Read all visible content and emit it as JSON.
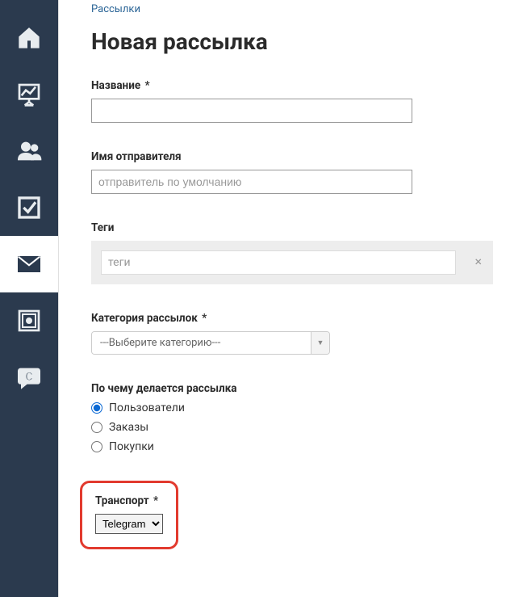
{
  "breadcrumb": "Рассылки",
  "page_title": "Новая рассылка",
  "fields": {
    "name": {
      "label": "Название",
      "required": "*",
      "value": ""
    },
    "sender": {
      "label": "Имя отправителя",
      "placeholder": "отправитель по умолчанию",
      "value": ""
    },
    "tags": {
      "label": "Теги",
      "placeholder": "теги"
    },
    "category": {
      "label": "Категория рассылок",
      "required": "*",
      "selected": "---Выберите категорию---"
    },
    "basis": {
      "label": "По чему делается рассылка",
      "options": [
        {
          "label": "Пользователи",
          "checked": true
        },
        {
          "label": "Заказы",
          "checked": false
        },
        {
          "label": "Покупки",
          "checked": false
        }
      ]
    },
    "transport": {
      "label": "Транспорт",
      "required": "*",
      "selected": "Telegram"
    }
  }
}
